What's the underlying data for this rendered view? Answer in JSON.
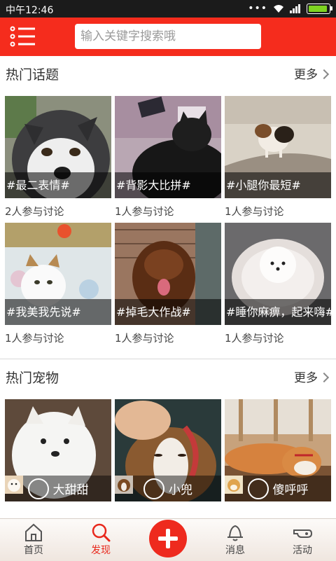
{
  "status": {
    "time": "中午12:46"
  },
  "header": {
    "search_placeholder": "输入关键字搜索哦"
  },
  "hot_topics": {
    "title": "热门话题",
    "more": "更多",
    "items": [
      {
        "caption": "#最二表情#",
        "count": "2人参与讨论",
        "image": "husky-photo"
      },
      {
        "caption": "#背影大比拼#",
        "count": "1人参与讨论",
        "image": "black-cat-photo"
      },
      {
        "caption": "#小腿你最短#",
        "count": "1人参与讨论",
        "image": "beagle-photo"
      },
      {
        "caption": "#我美我先说#",
        "count": "1人参与讨论",
        "image": "white-cat-photo"
      },
      {
        "caption": "#掉毛大作战#",
        "count": "1人参与讨论",
        "image": "mastiff-photo"
      },
      {
        "caption": "#睡你麻痹，起来嗨#",
        "count": "1人参与讨论",
        "image": "pomeranian-photo"
      }
    ]
  },
  "hot_pets": {
    "title": "热门宠物",
    "more": "更多",
    "items": [
      {
        "name": "大甜甜",
        "image": "samoyed-photo"
      },
      {
        "name": "小兜",
        "image": "beagle-sleeping-photo"
      },
      {
        "name": "傻呼呼",
        "image": "shiba-photo"
      }
    ]
  },
  "bottom_nav": {
    "items": [
      {
        "label": "首页",
        "icon": "home-icon"
      },
      {
        "label": "发现",
        "icon": "search-icon",
        "active": true
      },
      {
        "label": "",
        "icon": "plus-icon"
      },
      {
        "label": "消息",
        "icon": "bell-icon"
      },
      {
        "label": "活动",
        "icon": "whistle-icon"
      }
    ]
  },
  "colors": {
    "brand": "#f52c1d",
    "active_nav": "#e8281c"
  }
}
